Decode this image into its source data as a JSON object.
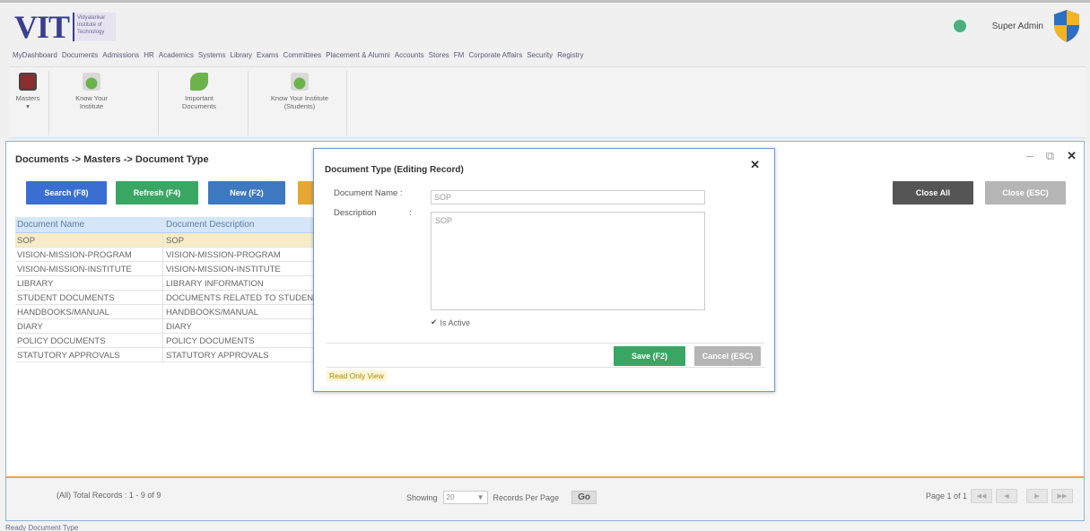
{
  "header": {
    "logo_text": "VIT",
    "logo_subtext": "Vidyalankar Institute of Technology",
    "user_name": "Super Admin",
    "nav": [
      "MyDashboard",
      "Documents",
      "Admissions",
      "HR",
      "Academics",
      "Systems",
      "Library",
      "Exams",
      "Committees",
      "Placement & Alumni",
      "Accounts",
      "Stores",
      "FM",
      "Corporate Affairs",
      "Security",
      "Registry"
    ]
  },
  "ribbon": {
    "items": [
      {
        "label": "Masters",
        "icon": "masters-icon"
      },
      {
        "label": "Know Your Institute",
        "icon": "globe-icon"
      },
      {
        "label": "Important Documents",
        "icon": "leaf-icon"
      },
      {
        "label": "Know Your Institute (Students)",
        "icon": "globe-icon"
      }
    ]
  },
  "panel": {
    "breadcrumb": "Documents -> Masters -> Document Type",
    "buttons": {
      "search": "Search (F8)",
      "refresh": "Refresh (F4)",
      "new": "New (F2)",
      "close_all": "Close All",
      "close_esc": "Close (ESC)"
    },
    "grid": {
      "columns": [
        "Document Name",
        "Document Description"
      ],
      "rows": [
        [
          "SOP",
          "SOP"
        ],
        [
          "VISION-MISSION-PROGRAM",
          "VISION-MISSION-PROGRAM"
        ],
        [
          "VISION-MISSION-INSTITUTE",
          "VISION-MISSION-INSTITUTE"
        ],
        [
          "LIBRARY",
          "LIBRARY INFORMATION"
        ],
        [
          "STUDENT DOCUMENTS",
          "DOCUMENTS RELATED TO STUDENTS"
        ],
        [
          "HANDBOOKS/MANUAL",
          "HANDBOOKS/MANUAL"
        ],
        [
          "DIARY",
          "DIARY"
        ],
        [
          "POLICY DOCUMENTS",
          "POLICY DOCUMENTS"
        ],
        [
          "STATUTORY APPROVALS",
          "STATUTORY APPROVALS"
        ]
      ]
    },
    "footer": {
      "total_records": "(All) Total Records : 1 - 9 of 9",
      "showing_label": "Showing",
      "per_page_value": "20",
      "per_page_label": "Records Per Page",
      "go_label": "Go",
      "page_info": "Page 1 of 1"
    }
  },
  "modal": {
    "title": "Document Type (Editing Record)",
    "document_name_label": "Document Name :",
    "document_name_value": "SOP",
    "description_label": "Description",
    "description_colon": ":",
    "description_value": "SOP",
    "is_active_label": "Is Active",
    "save_label": "Save (F2)",
    "cancel_label": "Cancel (ESC)",
    "readonly_label": "Read Only View"
  },
  "status_bar": "Ready  Document Type",
  "colors": {
    "accent_blue": "#3a6fd1",
    "green": "#3aa664",
    "orange": "#f0a04a",
    "selected_row": "#f7ecc5"
  }
}
